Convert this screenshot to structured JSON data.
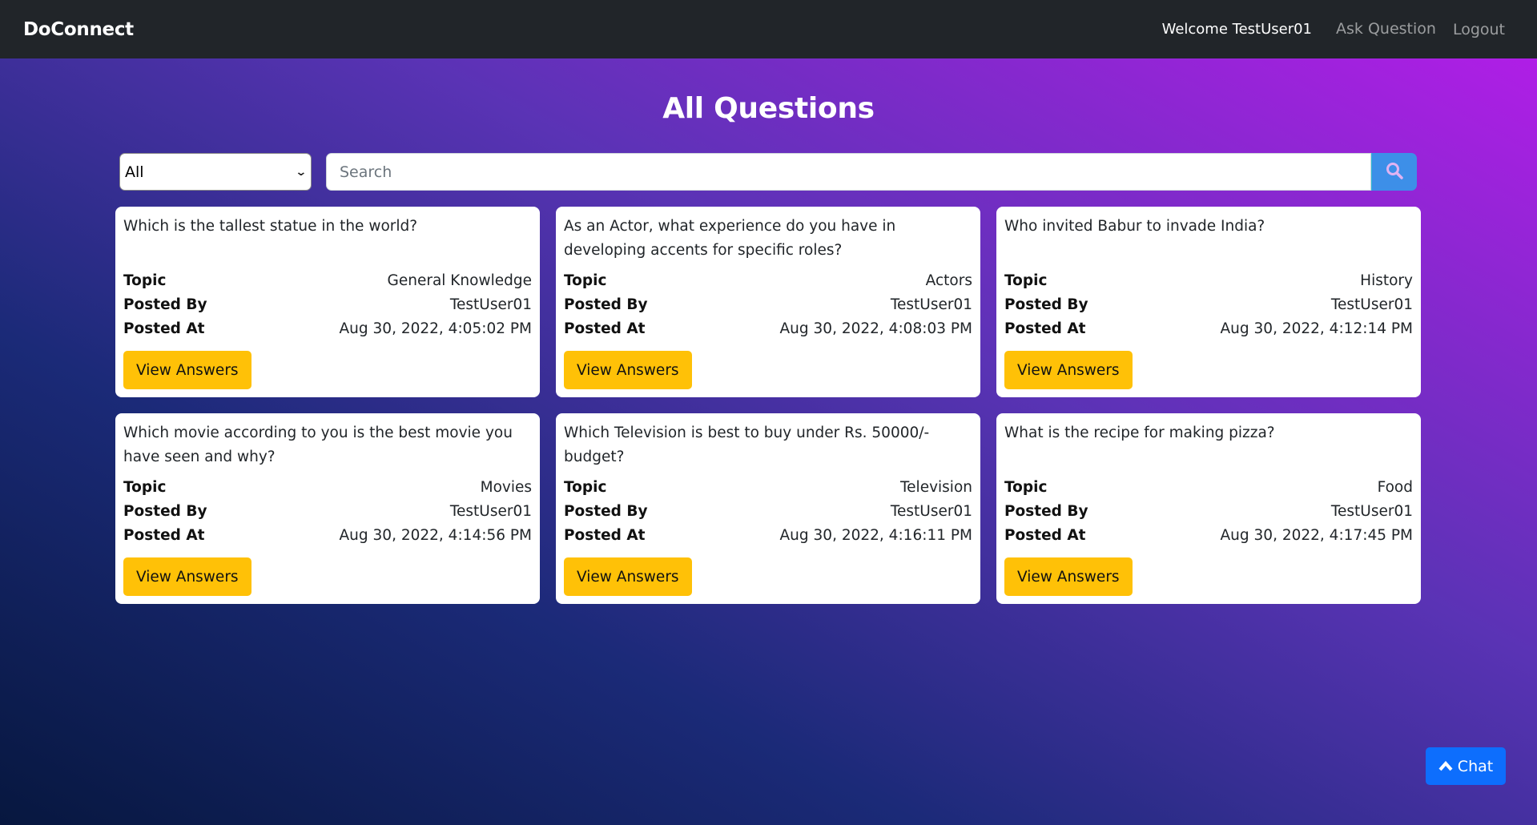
{
  "navbar": {
    "brand": "DoConnect",
    "welcome": "Welcome TestUser01",
    "ask_question": "Ask Question",
    "logout": "Logout"
  },
  "page": {
    "title": "All Questions"
  },
  "filters": {
    "topic_selected": "All",
    "search_placeholder": "Search",
    "search_value": "",
    "search_icon": "search-icon"
  },
  "labels": {
    "topic": "Topic",
    "posted_by": "Posted By",
    "posted_at": "Posted At",
    "view_answers": "View Answers"
  },
  "questions": [
    {
      "question": "Which is the tallest statue in the world?",
      "topic": "General Knowledge",
      "posted_by": "TestUser01",
      "posted_at": "Aug 30, 2022, 4:05:02 PM"
    },
    {
      "question": "As an Actor, what experience do you have in developing accents for specific roles?",
      "topic": "Actors",
      "posted_by": "TestUser01",
      "posted_at": "Aug 30, 2022, 4:08:03 PM"
    },
    {
      "question": "Who invited Babur to invade India?",
      "topic": "History",
      "posted_by": "TestUser01",
      "posted_at": "Aug 30, 2022, 4:12:14 PM"
    },
    {
      "question": "Which movie according to you is the best movie you have seen and why?",
      "topic": "Movies",
      "posted_by": "TestUser01",
      "posted_at": "Aug 30, 2022, 4:14:56 PM"
    },
    {
      "question": "Which Television is best to buy under Rs. 50000/- budget?",
      "topic": "Television",
      "posted_by": "TestUser01",
      "posted_at": "Aug 30, 2022, 4:16:11 PM"
    },
    {
      "question": "What is the recipe for making pizza?",
      "topic": "Food",
      "posted_by": "TestUser01",
      "posted_at": "Aug 30, 2022, 4:17:45 PM"
    }
  ],
  "chat": {
    "label": "Chat",
    "icon": "chevron-up-icon"
  },
  "colors": {
    "navbar_bg": "#212529",
    "accent_yellow": "#ffc107",
    "chat_blue": "#0d6efd",
    "search_btn": "#3d8fe8"
  }
}
